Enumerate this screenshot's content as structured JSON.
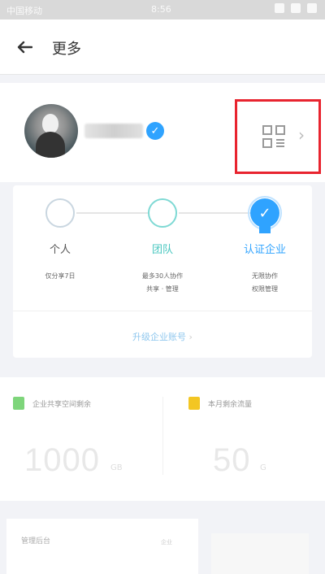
{
  "status_bar": {
    "carrier": "中国移动",
    "time": "8:56"
  },
  "header": {
    "title": "更多"
  },
  "profile": {
    "name": ""
  },
  "levels": [
    {
      "label": "个人",
      "desc": [
        "仅分享7日"
      ],
      "color": "#555555"
    },
    {
      "label": "团队",
      "desc": [
        "最多30人协作",
        "共享 · 管理"
      ],
      "color": "#49c7c0"
    },
    {
      "label": "认证企业",
      "desc": [
        "无限协作",
        "权限管理"
      ],
      "color": "#2fa3ff"
    }
  ],
  "upgrade_link": "升级企业账号",
  "stats": [
    {
      "label": "企业共享空间剩余",
      "value": "1000",
      "unit": "GB",
      "icon_color": "#7ed57b"
    },
    {
      "label": "本月剩余流量",
      "value": "50",
      "unit": "G",
      "icon_color": "#f3c623"
    }
  ],
  "bottom": {
    "left_text": "管理后台",
    "left_tag": "企业"
  },
  "colors": {
    "accent": "#2fa3ff",
    "highlight": "#e8242f"
  }
}
